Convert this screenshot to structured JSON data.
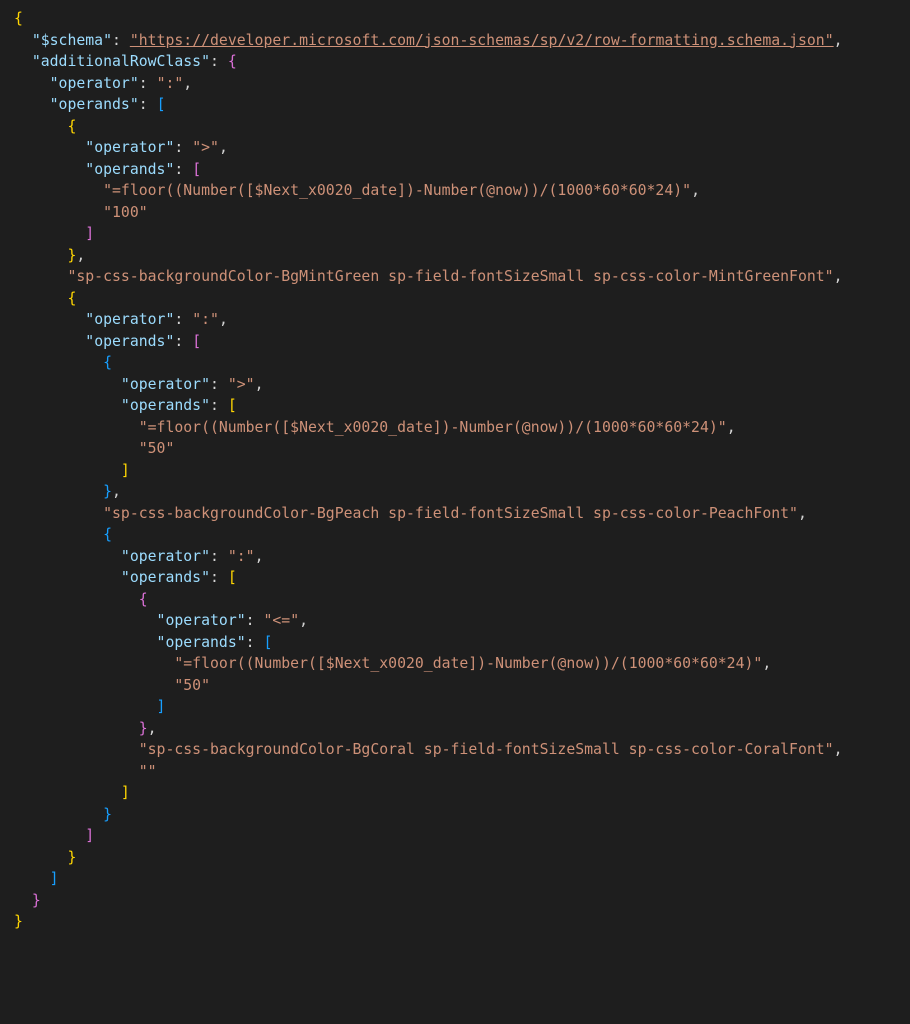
{
  "code": {
    "schema_key": "\"$schema\"",
    "schema_val": "\"https://developer.microsoft.com/json-schemas/sp/v2/row-formatting.schema.json\"",
    "rowclass_key": "\"additionalRowClass\"",
    "operator_key": "\"operator\"",
    "operands_key": "\"operands\"",
    "op_ternary": "\":\"",
    "op_gt": "\">\"",
    "op_lte": "\"<=\"",
    "expr": "\"=floor((Number([$Next_x0020_date])-Number(@now))/(1000*60*60*24)\"",
    "val100": "\"100\"",
    "val50": "\"50\"",
    "class_mint": "\"sp-css-backgroundColor-BgMintGreen sp-field-fontSizeSmall sp-css-color-MintGreenFont\"",
    "class_peach": "\"sp-css-backgroundColor-BgPeach sp-field-fontSizeSmall sp-css-color-PeachFont\"",
    "class_coral": "\"sp-css-backgroundColor-BgCoral sp-field-fontSizeSmall sp-css-color-CoralFont\"",
    "empty": "\"\""
  }
}
